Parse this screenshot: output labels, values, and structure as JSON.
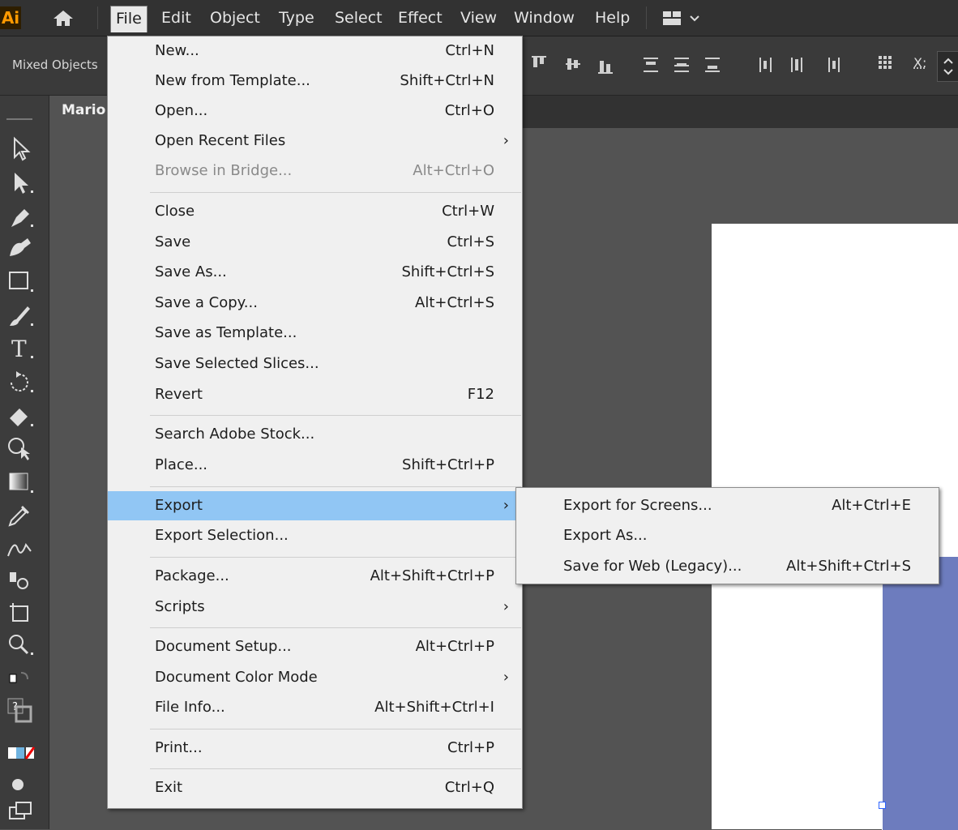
{
  "app": {
    "logo": "Ai"
  },
  "menubar": {
    "items": [
      "File",
      "Edit",
      "Object",
      "Type",
      "Select",
      "Effect",
      "View",
      "Window",
      "Help"
    ]
  },
  "controlbar": {
    "selection_label": "Mixed Objects",
    "x_label": "X:"
  },
  "document": {
    "tab_label": "Mario"
  },
  "file_menu": {
    "items": [
      {
        "label": "New...",
        "shortcut": "Ctrl+N"
      },
      {
        "label": "New from Template...",
        "shortcut": "Shift+Ctrl+N"
      },
      {
        "label": "Open...",
        "shortcut": "Ctrl+O"
      },
      {
        "label": "Open Recent Files",
        "submenu": "›"
      },
      {
        "label": "Browse in Bridge...",
        "shortcut": "Alt+Ctrl+O",
        "disabled": true
      },
      {
        "label": "Close",
        "shortcut": "Ctrl+W"
      },
      {
        "label": "Save",
        "shortcut": "Ctrl+S"
      },
      {
        "label": "Save As...",
        "shortcut": "Shift+Ctrl+S"
      },
      {
        "label": "Save a Copy...",
        "shortcut": "Alt+Ctrl+S"
      },
      {
        "label": "Save as Template..."
      },
      {
        "label": "Save Selected Slices..."
      },
      {
        "label": "Revert",
        "shortcut": "F12"
      },
      {
        "label": "Search Adobe Stock..."
      },
      {
        "label": "Place...",
        "shortcut": "Shift+Ctrl+P"
      },
      {
        "label": "Export",
        "submenu": "›",
        "highlighted": true
      },
      {
        "label": "Export Selection..."
      },
      {
        "label": "Package...",
        "shortcut": "Alt+Shift+Ctrl+P"
      },
      {
        "label": "Scripts",
        "submenu": "›"
      },
      {
        "label": "Document Setup...",
        "shortcut": "Alt+Ctrl+P"
      },
      {
        "label": "Document Color Mode",
        "submenu": "›"
      },
      {
        "label": "File Info...",
        "shortcut": "Alt+Shift+Ctrl+I"
      },
      {
        "label": "Print...",
        "shortcut": "Ctrl+P"
      },
      {
        "label": "Exit",
        "shortcut": "Ctrl+Q"
      }
    ]
  },
  "export_submenu": {
    "items": [
      {
        "label": "Export for Screens...",
        "shortcut": "Alt+Ctrl+E"
      },
      {
        "label": "Export As..."
      },
      {
        "label": "Save for Web (Legacy)...",
        "shortcut": "Alt+Shift+Ctrl+S"
      }
    ]
  },
  "colors": {
    "menu_highlight": "#91c6f4",
    "shape_fill": "#6d7cbe",
    "logo_orange": "#ff9a00"
  }
}
